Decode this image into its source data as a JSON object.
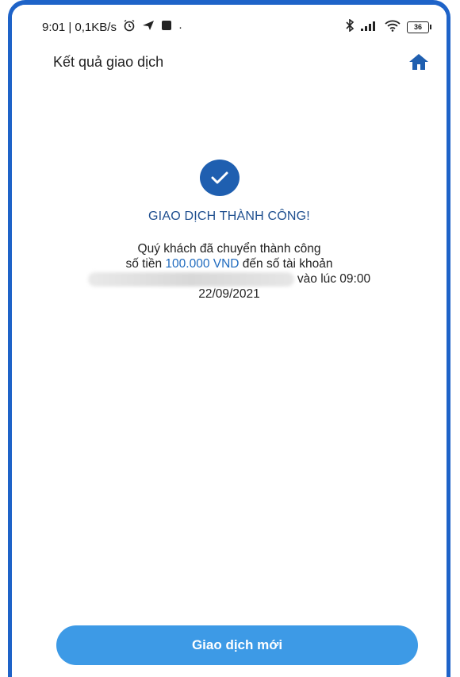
{
  "status_bar": {
    "left_text": "9:01 | 0,1KB/s",
    "dot": "·",
    "battery": "36",
    "icons": [
      "alarm-icon",
      "send-icon",
      "app-icon",
      "bluetooth-icon",
      "signal-icon",
      "wifi-icon",
      "battery-icon"
    ]
  },
  "header": {
    "title": "Kết quả giao dịch",
    "home_icon": "home-icon"
  },
  "result": {
    "title": "GIAO DỊCH THÀNH CÔNG!",
    "line1": "Quý khách đã chuyển thành công",
    "line2_prefix": "số tiền ",
    "amount": "100.000 VND",
    "line2_suffix": " đến số tài khoản",
    "line3_suffix": "vào lúc 09:00",
    "date": "22/09/2021"
  },
  "actions": {
    "new_transaction": "Giao dịch mới"
  },
  "colors": {
    "frame": "#1e63c8",
    "success_circle": "#1f5fb0",
    "title": "#1f4f8f",
    "amount": "#1f6bbf",
    "button": "#3d9ae6"
  }
}
